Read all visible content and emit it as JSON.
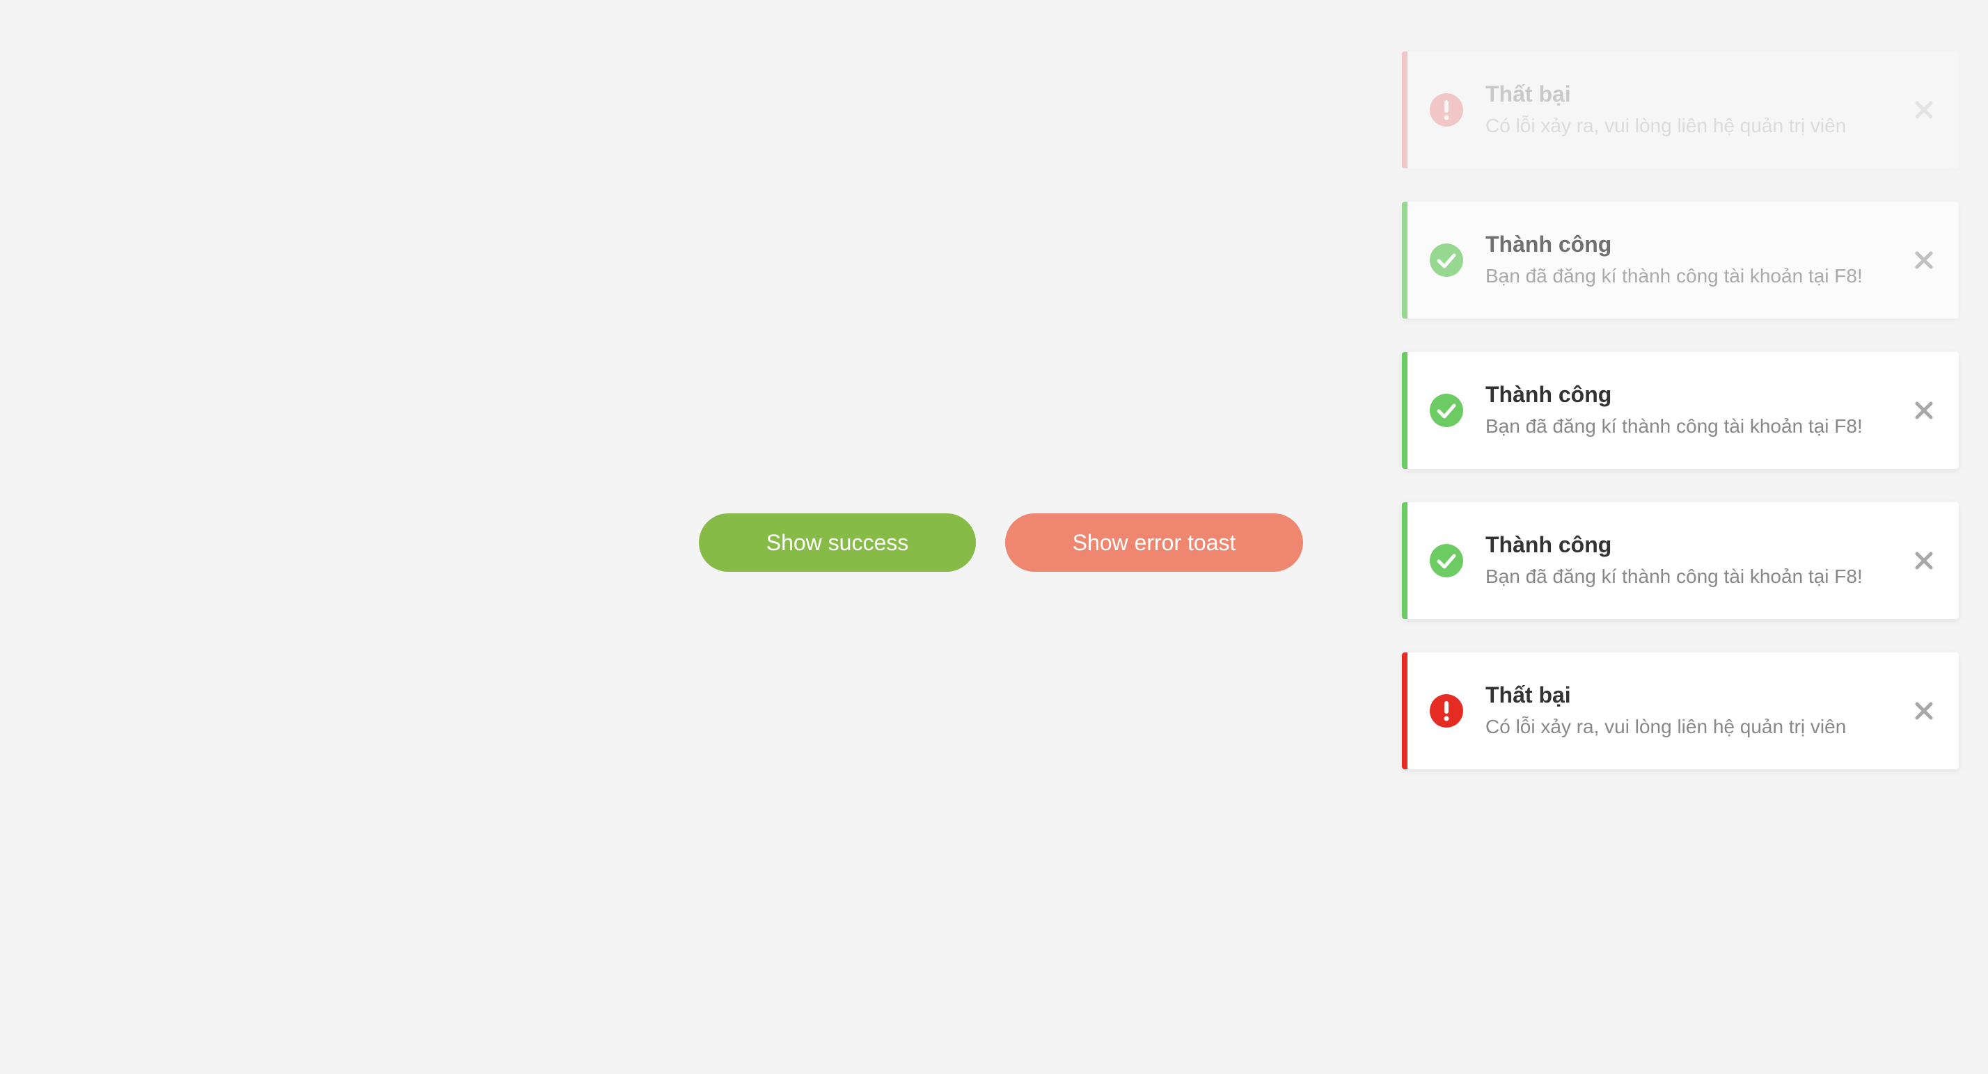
{
  "buttons": {
    "success_label": "Show success",
    "error_label": "Show error toast"
  },
  "toasts": [
    {
      "type": "error",
      "title": "Thất bại",
      "message": "Có lỗi xảy ra, vui lòng liên hệ quản trị viên",
      "icon": "exclamation-circle-icon",
      "opacity": 0.22
    },
    {
      "type": "success",
      "title": "Thành công",
      "message": "Bạn đã đăng kí thành công tài khoản tại F8!",
      "icon": "check-circle-icon",
      "opacity": 0.68
    },
    {
      "type": "success",
      "title": "Thành công",
      "message": "Bạn đã đăng kí thành công tài khoản tại F8!",
      "icon": "check-circle-icon",
      "opacity": 1
    },
    {
      "type": "success",
      "title": "Thành công",
      "message": "Bạn đã đăng kí thành công tài khoản tại F8!",
      "icon": "check-circle-icon",
      "opacity": 1
    },
    {
      "type": "error",
      "title": "Thất bại",
      "message": "Có lỗi xảy ra, vui lòng liên hệ quản trị viên",
      "icon": "exclamation-circle-icon",
      "opacity": 1
    }
  ],
  "colors": {
    "background": "#f4f4f5",
    "success": "#6ccb62",
    "error": "#e42c23",
    "success_button": "#86bb48",
    "error_button": "#ef8770"
  }
}
